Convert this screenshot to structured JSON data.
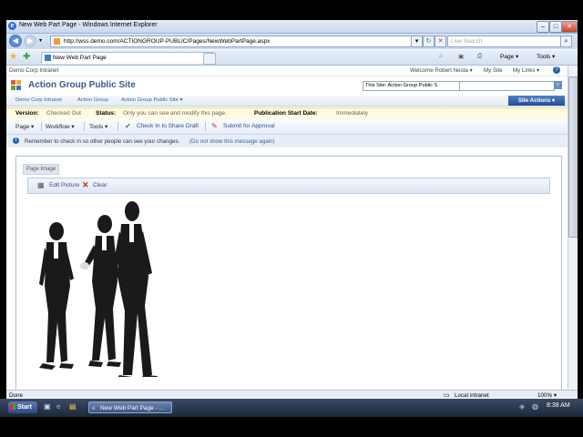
{
  "window": {
    "title": "New Web Part Page - Windows Internet Explorer"
  },
  "address": {
    "url": "http://wss.demo.com/ACTIONGROUP-PUBLIC/Pages/NewWebPartPage.aspx",
    "search_placeholder": "Live Search"
  },
  "browser_tab": {
    "label": "New Web Part Page"
  },
  "commands": {
    "page": "Page ▾",
    "tools": "Tools ▾"
  },
  "sp": {
    "top_left": "Demo Corp Intranet",
    "welcome": "Welcome Robert Nesta ▾",
    "my_site": "My Site",
    "my_links": "My Links ▾",
    "site_title": "Action Group Public Site",
    "search_scope": "This Site: Action Group Public S",
    "nav": [
      "Demo Corp Intranet",
      "Action Group",
      "Action Group Public Site ▾"
    ],
    "site_actions": "Site Actions ▾"
  },
  "status": {
    "version_label": "Version:",
    "version_value": "Checked Out",
    "status_label": "Status:",
    "status_value": "Only you can see and modify this page.",
    "pub_label": "Publication Start Date:",
    "pub_value": "Immediately"
  },
  "toolbar": {
    "page": "Page ▾",
    "workflow": "Workflow ▾",
    "tools": "Tools ▾",
    "check_in": "Check In to Share Draft",
    "submit": "Submit for Approval"
  },
  "message": {
    "text": "Remember to check in so other people can see your changes.",
    "dismiss": "(Do not show this message again)"
  },
  "zone": {
    "label": "Page Image"
  },
  "picture_toolbar": {
    "edit": "Edit Picture",
    "clear": "Clear"
  },
  "ie_status": {
    "left": "Done",
    "zone": "Local intranet",
    "zoom": "100% ▾"
  },
  "taskbar": {
    "start": "Start",
    "task": "New Web Part Page - ...",
    "clock": "8:38 AM"
  }
}
